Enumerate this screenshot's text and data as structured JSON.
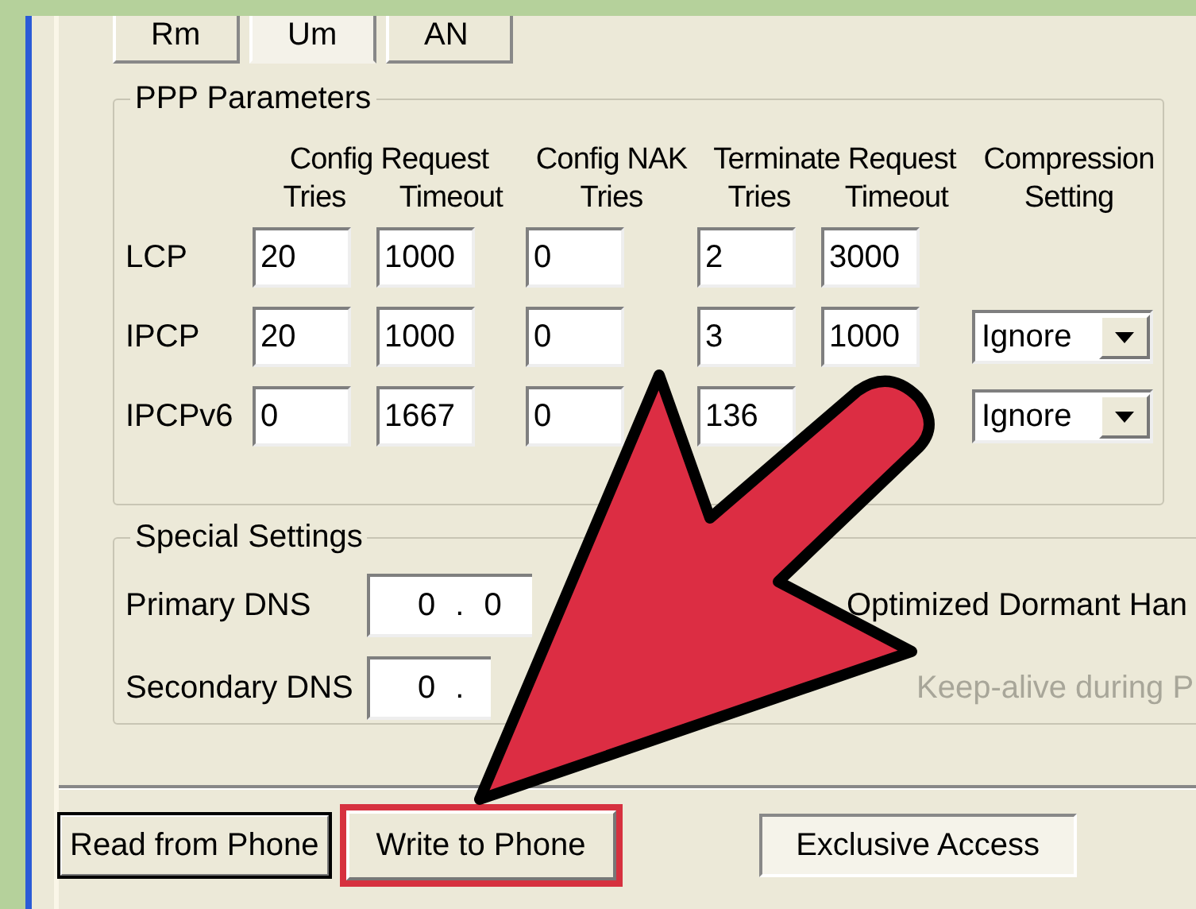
{
  "tabs": [
    {
      "label": "Rm",
      "selected": false
    },
    {
      "label": "Um",
      "selected": true
    },
    {
      "label": "AN",
      "selected": false
    }
  ],
  "ppp_parameters": {
    "title": "PPP Parameters",
    "header_groups": [
      {
        "label": "Config Request",
        "columns": [
          "Tries",
          "Timeout"
        ]
      },
      {
        "label": "Config NAK",
        "columns": [
          "Tries"
        ]
      },
      {
        "label": "Terminate Request",
        "columns": [
          "Tries",
          "Timeout"
        ]
      },
      {
        "label": "Compression",
        "columns": [
          "Setting"
        ]
      }
    ],
    "rows": [
      {
        "label": "LCP",
        "values": [
          "20",
          "1000",
          "0",
          "2",
          "3000"
        ]
      },
      {
        "label": "IPCP",
        "values": [
          "20",
          "1000",
          "0",
          "3",
          "1000"
        ],
        "compression": "Ignore"
      },
      {
        "label": "IPCPv6",
        "values": [
          "0",
          "1667",
          "0",
          "136"
        ],
        "compression": "Ignore"
      }
    ]
  },
  "special_settings": {
    "title": "Special Settings",
    "fields": [
      {
        "label": "Primary DNS",
        "value": "0 . 0",
        "option": {
          "label": "Optimized Dormant Han",
          "disabled": false
        }
      },
      {
        "label": "Secondary DNS",
        "value": "0 .",
        "option": {
          "label": "Keep-alive during P",
          "disabled": true
        }
      }
    ]
  },
  "buttons": [
    {
      "label": "Read from Phone",
      "kind": "default",
      "highlighted": false
    },
    {
      "label": "Write to Phone",
      "kind": "normal",
      "highlighted": true
    },
    {
      "label": "Exclusive Access",
      "kind": "toggle",
      "highlighted": false
    }
  ]
}
